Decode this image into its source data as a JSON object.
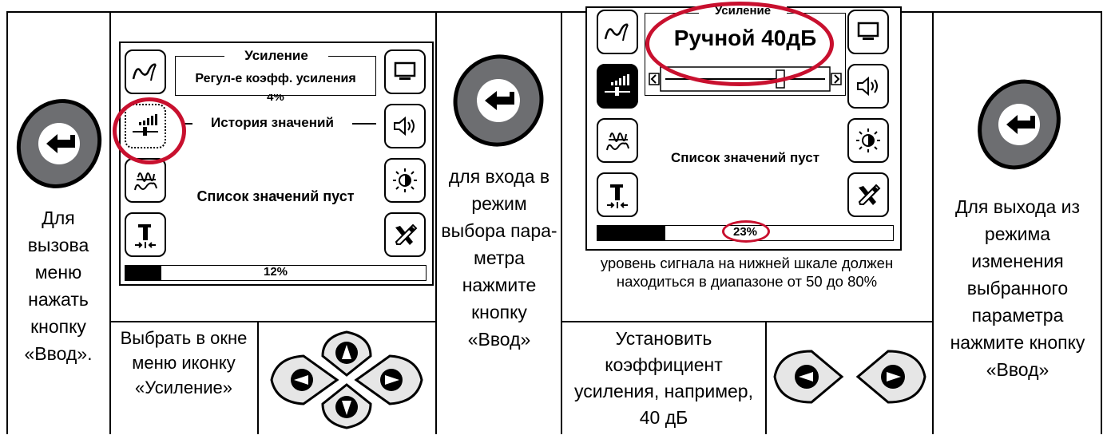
{
  "col1": {
    "instruction": "Для вызова меню нажать кнопку «Ввод»."
  },
  "screen1": {
    "gain_title": "Усиление",
    "gain_line": "Регул-е коэфф. усиления",
    "gain_value_fragment": "4%",
    "history_title": "История значений",
    "list_empty": "Список значений пуст",
    "progress": {
      "label": "12%",
      "value": 0.12
    }
  },
  "col2_bottom": {
    "instruction": "Выбрать в окне меню иконку «Усиление»"
  },
  "col3": {
    "instruction": "для входа в режим выбора пара-метра нажмите кнопку «Ввод»"
  },
  "screen2": {
    "gain_title": "Усиление",
    "gain_mode": "Ручной 40дБ",
    "slider_value": 0.72,
    "list_empty": "Список значений пуст",
    "progress": {
      "label": "23%",
      "value": 0.23
    },
    "caption": "уровень сигнала на нижней шкале должен находиться в диапазоне от 50 до 80%"
  },
  "col4_bottom": {
    "instruction": "Установить коэффициент усиления, например, 40 дБ"
  },
  "col5": {
    "instruction": "Для выхода из режима изменения выбранного параметра нажмите кнопку «Ввод»"
  },
  "colors": {
    "accent": "#c8102e",
    "button_grey": "#6d6e71"
  },
  "icons": [
    "enter-key-icon",
    "waveform-icon",
    "gain-bars-icon",
    "filter-icon",
    "probe-icon",
    "monitor-icon",
    "speaker-icon",
    "brightness-icon",
    "tools-icon",
    "arrow-cross-keys-icon",
    "left-right-keys-icon"
  ]
}
